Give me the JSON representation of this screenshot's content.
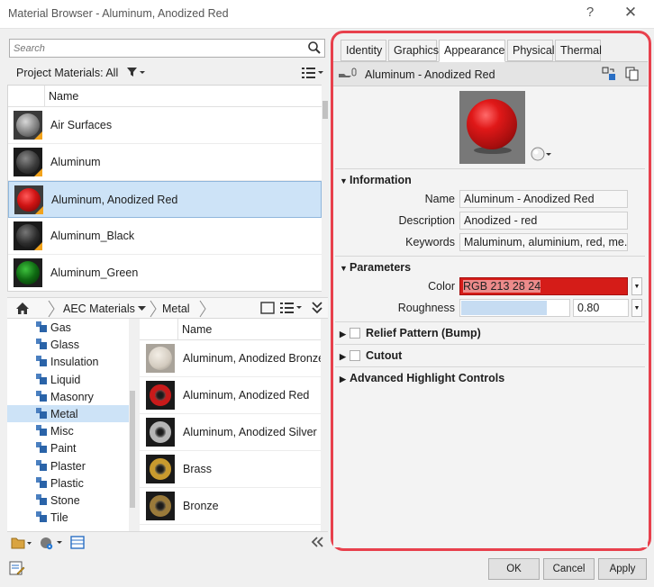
{
  "window": {
    "title": "Material Browser - Aluminum, Anodized Red",
    "help": "?",
    "close": "✕"
  },
  "search": {
    "placeholder": "Search"
  },
  "project": {
    "label": "Project Materials: All",
    "column_header": "Name",
    "materials": [
      {
        "name": "Air Surfaces",
        "color": "#8a8a8a"
      },
      {
        "name": "Aluminum",
        "color": "#2e2e2e"
      },
      {
        "name": "Aluminum, Anodized Red",
        "color": "#d01414",
        "selected": true
      },
      {
        "name": "Aluminum_Black",
        "color": "#262626"
      },
      {
        "name": "Aluminum_Green",
        "color": "#0f6a12"
      }
    ]
  },
  "breadcrumb": {
    "library": "AEC Materials",
    "category": "Metal"
  },
  "tree": {
    "items": [
      {
        "label": "Gas"
      },
      {
        "label": "Glass"
      },
      {
        "label": "Insulation"
      },
      {
        "label": "Liquid"
      },
      {
        "label": "Masonry"
      },
      {
        "label": "Metal",
        "selected": true
      },
      {
        "label": "Misc"
      },
      {
        "label": "Paint"
      },
      {
        "label": "Plaster"
      },
      {
        "label": "Plastic"
      },
      {
        "label": "Stone"
      },
      {
        "label": "Tile"
      }
    ]
  },
  "library": {
    "column_header": "Name",
    "items": [
      {
        "name": "Aluminum, Anodized Bronze",
        "color": "#d8d2c8"
      },
      {
        "name": "Aluminum, Anodized Red",
        "color": "#c81a1a"
      },
      {
        "name": "Aluminum, Anodized Silver",
        "color": "#b8b8b8"
      },
      {
        "name": "Brass",
        "color": "#c89a2e"
      },
      {
        "name": "Bronze",
        "color": "#9a7a3a"
      }
    ]
  },
  "tabs": [
    "Identity",
    "Graphics",
    "Appearance",
    "Physical",
    "Thermal"
  ],
  "active_tab": "Appearance",
  "asset": {
    "name": "Aluminum - Anodized Red"
  },
  "information": {
    "title": "Information",
    "name_label": "Name",
    "name_value": "Aluminum - Anodized Red",
    "description_label": "Description",
    "description_value": "Anodized - red",
    "keywords_label": "Keywords",
    "keywords_value": "Maluminum, aluminium, red, me..."
  },
  "parameters": {
    "title": "Parameters",
    "color_label": "Color",
    "color_value": "RGB 213 28 24",
    "color_swatch": "#d51c18",
    "roughness_label": "Roughness",
    "roughness_value": "0.80",
    "roughness_fraction": 0.8
  },
  "sections": {
    "relief": "Relief Pattern (Bump)",
    "cutout": "Cutout",
    "advanced": "Advanced Highlight Controls"
  },
  "buttons": {
    "ok": "OK",
    "cancel": "Cancel",
    "apply": "Apply"
  },
  "highlight_color": "#e8404c"
}
